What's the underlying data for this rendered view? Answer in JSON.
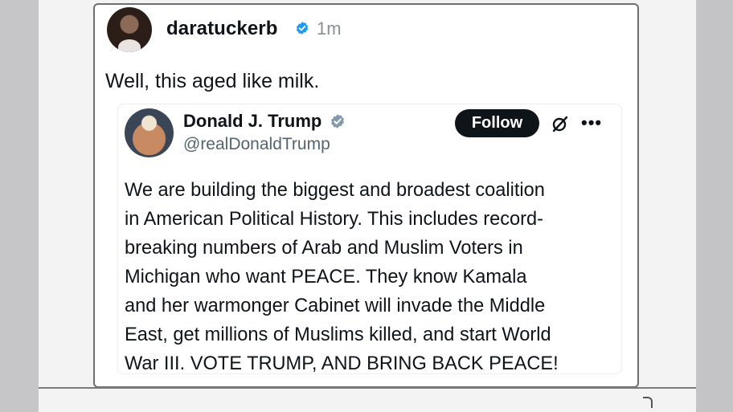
{
  "post": {
    "username": "daratuckerb",
    "timestamp": "1m",
    "text": "Well, this aged like milk."
  },
  "quoted_post": {
    "display_name": "Donald J. Trump",
    "handle": "@realDonaldTrump",
    "follow_label": "Follow",
    "more_label": "•••",
    "body_lines": [
      "We are building the biggest and broadest coalition",
      "in American Political History. This includes record-",
      "breaking numbers of Arab and Muslim Voters in",
      "Michigan who want PEACE. They know Kamala",
      "and her warmonger Cabinet will invade the Middle",
      "East, get millions of Muslims killed, and start World",
      "War III. VOTE TRUMP, AND BRING BACK PEACE!"
    ]
  },
  "icons": {
    "verified_top": "verified-badge-icon",
    "verified_quote": "verified-badge-icon",
    "grok": "grok-icon",
    "more": "more-options-icon"
  },
  "colors": {
    "verified_top": "#1d9bf0",
    "verified_quote": "#829aab",
    "follow_bg": "#0f1419",
    "handle": "#536471",
    "timestamp": "#8a8f94"
  }
}
